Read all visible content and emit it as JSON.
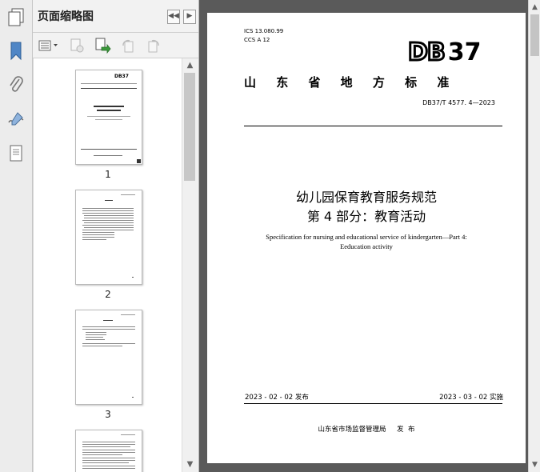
{
  "panel": {
    "title": "页面缩略图",
    "thumbnails": [
      {
        "number": "1"
      },
      {
        "number": "2"
      },
      {
        "number": "3"
      }
    ]
  },
  "icons": {
    "rail": [
      "pages-icon",
      "bookmark-icon",
      "attachment-icon",
      "signature-icon",
      "layers-icon"
    ],
    "toolbar": [
      "options-menu-icon",
      "delete-page-icon",
      "insert-page-icon",
      "rotate-left-icon",
      "rotate-right-icon"
    ]
  },
  "document": {
    "ics": "ICS  13.080.99",
    "ccs": "CCS  A  12",
    "logo_prefix": "DB",
    "logo_suffix": "37",
    "standard_type": "山  东  省  地  方  标  准",
    "standard_number": "DB37/T  4577. 4—2023",
    "title_line1": "幼儿园保育教育服务规范",
    "title_line2": "第 4 部分：教育活动",
    "english_line1": "Specification for nursing and educational service of kindergarten—Part 4:",
    "english_line2": "Eeducation activity",
    "publish_date": "2023 - 02 - 02 发布",
    "implement_date": "2023 - 03 - 02 实施",
    "issuer": "山东省市场监督管理局     发  布"
  },
  "colors": {
    "doc_background": "#5a5a5a",
    "panel_background": "#f2f2f2",
    "rail_background": "#ececec"
  }
}
